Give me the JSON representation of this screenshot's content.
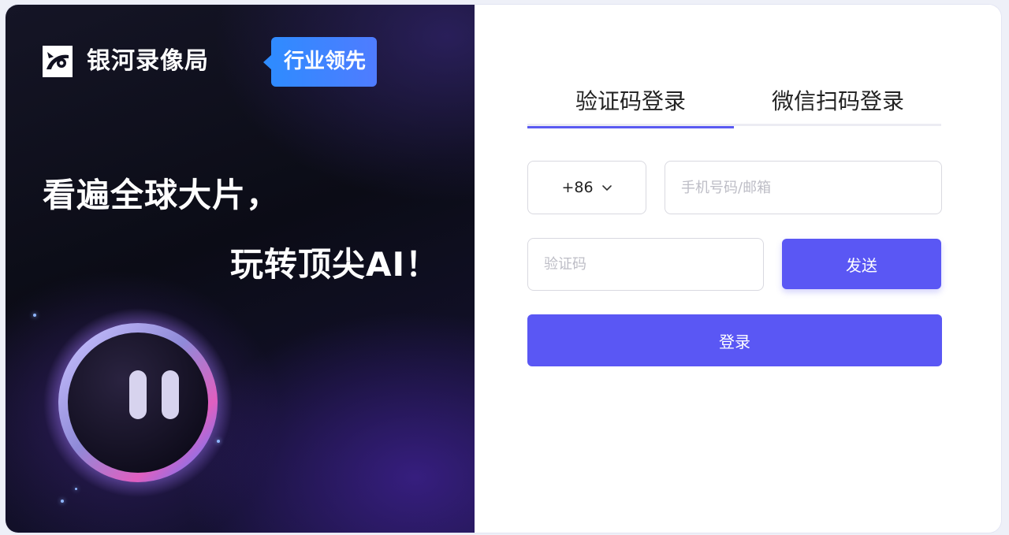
{
  "brand": {
    "name": "银河录像局",
    "badge": "行业领先"
  },
  "hero": {
    "line1": "看遍全球大片，",
    "line2": "玩转顶尖AI！"
  },
  "login_tabs": [
    {
      "label": "验证码登录",
      "active": true
    },
    {
      "label": "微信扫码登录",
      "active": false
    }
  ],
  "form": {
    "country_code": "+86",
    "phone_placeholder": "手机号码/邮箱",
    "code_placeholder": "验证码",
    "send_label": "发送",
    "login_label": "登录"
  },
  "colors": {
    "accent": "#5a57f4",
    "badge": "#2f8bff",
    "left_panel_bg": "#0b0c16"
  }
}
